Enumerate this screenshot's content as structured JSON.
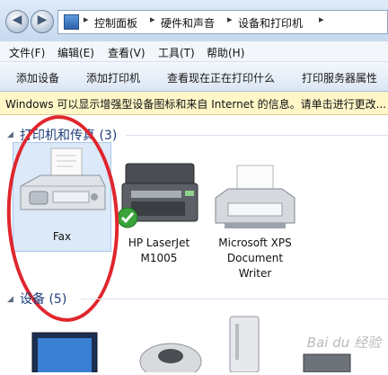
{
  "address_bar": {
    "breadcrumbs": [
      "控制面板",
      "硬件和声音",
      "设备和打印机"
    ],
    "separator": "▸"
  },
  "menu": [
    "文件(F)",
    "编辑(E)",
    "查看(V)",
    "工具(T)",
    "帮助(H)"
  ],
  "commands": [
    "添加设备",
    "添加打印机",
    "查看现在正在打印什么",
    "打印服务器属性"
  ],
  "info_bar": "Windows 可以显示增强型设备图标和来自 Internet 的信息。请单击进行更改...",
  "groups": {
    "printers": {
      "title": "打印机和传真 (3)"
    },
    "devices": {
      "title": "设备 (5)"
    }
  },
  "printers": [
    {
      "label": "Fax"
    },
    {
      "label": "HP LaserJet\nM1005"
    },
    {
      "label": "Microsoft XPS\nDocument\nWriter"
    }
  ],
  "watermark": "Bai du 经验",
  "colors": {
    "highlight_ring": "#e0262e",
    "info_bar": "#fff7c8",
    "group_header": "#1e3f7a"
  }
}
